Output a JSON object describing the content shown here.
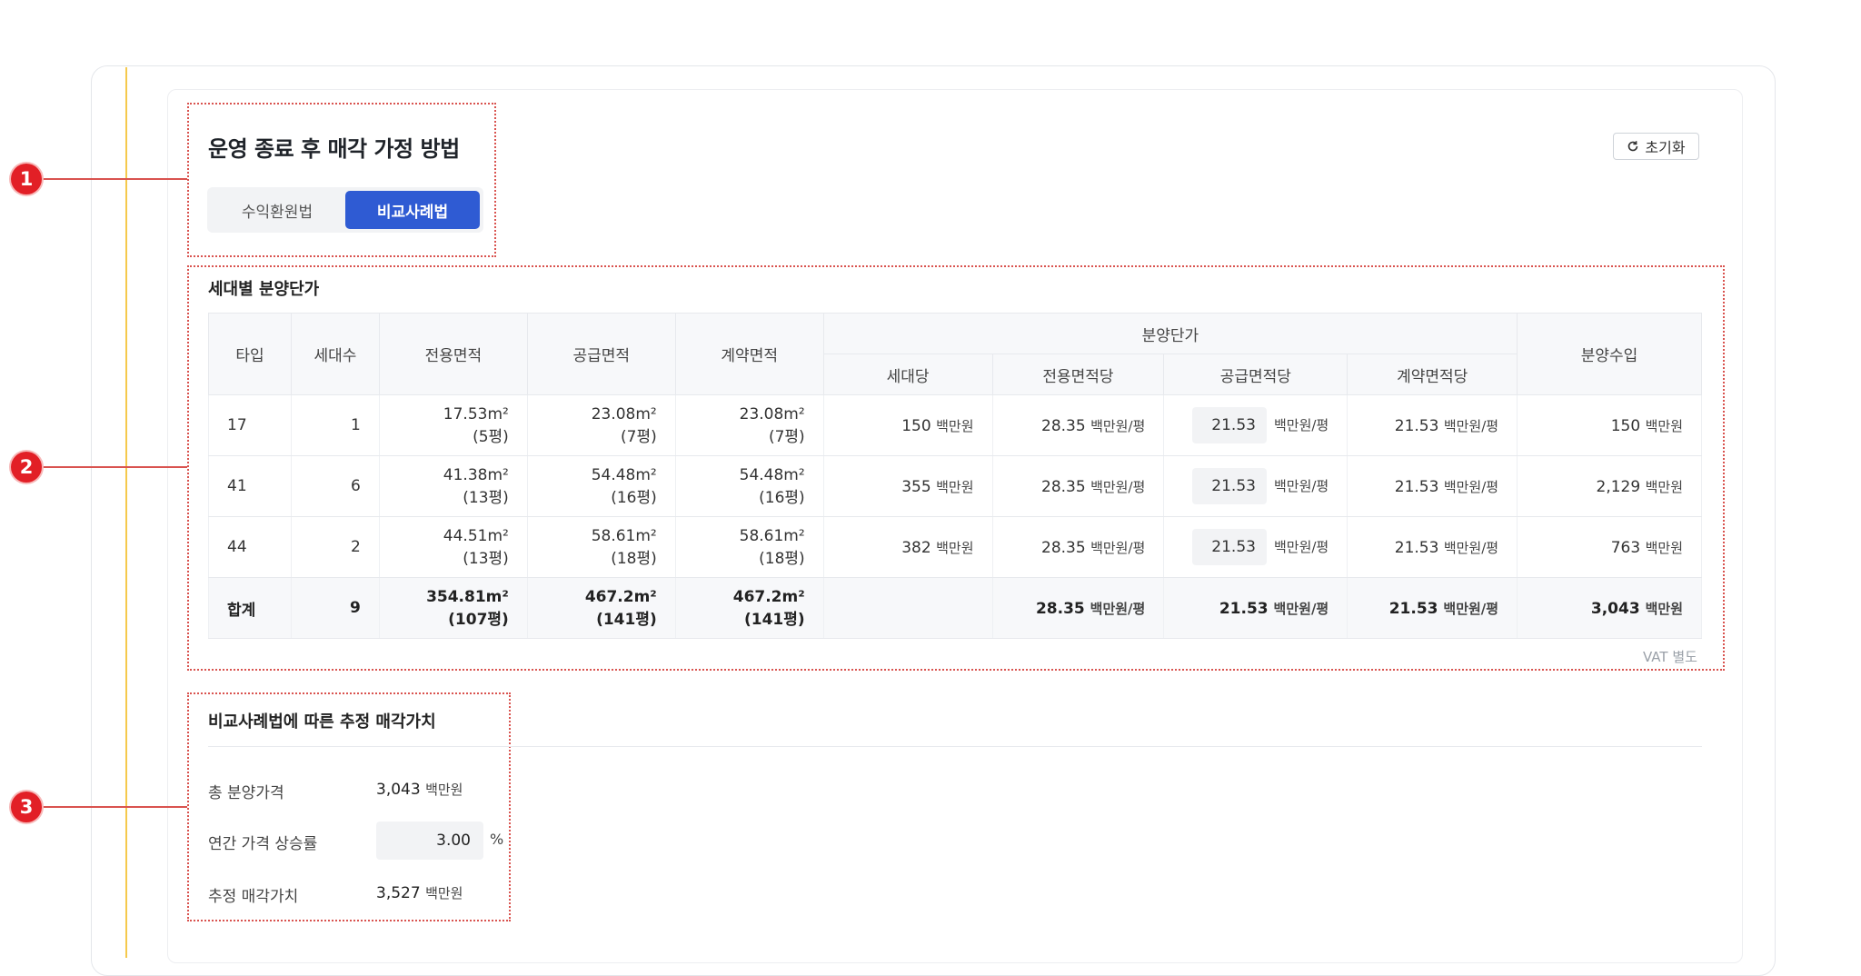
{
  "header": {
    "title": "운영 종료 후 매각 가정 방법",
    "reset_label": "초기화",
    "methods": [
      "수익환원법",
      "비교사례법"
    ],
    "selected_method": "비교사례법"
  },
  "markers": [
    "1",
    "2",
    "3"
  ],
  "unit_table": {
    "title": "세대별 분양단가",
    "headers": {
      "type": "타입",
      "units": "세대수",
      "exclusive_area": "전용면적",
      "supply_area": "공급면적",
      "contract_area": "계약면적",
      "price_group": "분양단가",
      "per_unit": "세대당",
      "per_exclusive": "전용면적당",
      "per_supply": "공급면적당",
      "per_contract": "계약면적당",
      "revenue": "분양수입"
    },
    "rows": [
      {
        "type": "17",
        "units": "1",
        "exclusive": "17.53m²",
        "exclusive_py": "(5평)",
        "supply": "23.08m²",
        "supply_py": "(7평)",
        "contract": "23.08m²",
        "contract_py": "(7평)",
        "per_unit": "150",
        "per_exclusive": "28.35",
        "per_supply": "21.53",
        "per_contract": "21.53",
        "revenue": "150"
      },
      {
        "type": "41",
        "units": "6",
        "exclusive": "41.38m²",
        "exclusive_py": "(13평)",
        "supply": "54.48m²",
        "supply_py": "(16평)",
        "contract": "54.48m²",
        "contract_py": "(16평)",
        "per_unit": "355",
        "per_exclusive": "28.35",
        "per_supply": "21.53",
        "per_contract": "21.53",
        "revenue": "2,129"
      },
      {
        "type": "44",
        "units": "2",
        "exclusive": "44.51m²",
        "exclusive_py": "(13평)",
        "supply": "58.61m²",
        "supply_py": "(18평)",
        "contract": "58.61m²",
        "contract_py": "(18평)",
        "per_unit": "382",
        "per_exclusive": "28.35",
        "per_supply": "21.53",
        "per_contract": "21.53",
        "revenue": "763"
      }
    ],
    "total": {
      "label": "합계",
      "units": "9",
      "exclusive": "354.81m²",
      "exclusive_py": "(107평)",
      "supply": "467.2m²",
      "supply_py": "(141평)",
      "contract": "467.2m²",
      "contract_py": "(141평)",
      "per_exclusive": "28.35",
      "per_supply": "21.53",
      "per_contract": "21.53",
      "revenue": "3,043"
    },
    "unit_million": "백만원",
    "unit_per_py": "백만원/평",
    "vat_note": "VAT 별도"
  },
  "estimate": {
    "title": "비교사례법에 따른 추정 매각가치",
    "total_price_label": "총 분양가격",
    "total_price_value": "3,043",
    "growth_label": "연간 가격 상승률",
    "growth_value": "3.00",
    "growth_unit": "%",
    "estimated_label": "추정 매각가치",
    "estimated_value": "3,527",
    "unit": "백만원"
  },
  "colors": {
    "accent": "#2f5bd3",
    "annotation": "#e21f26",
    "guide": "#f5c94d"
  }
}
